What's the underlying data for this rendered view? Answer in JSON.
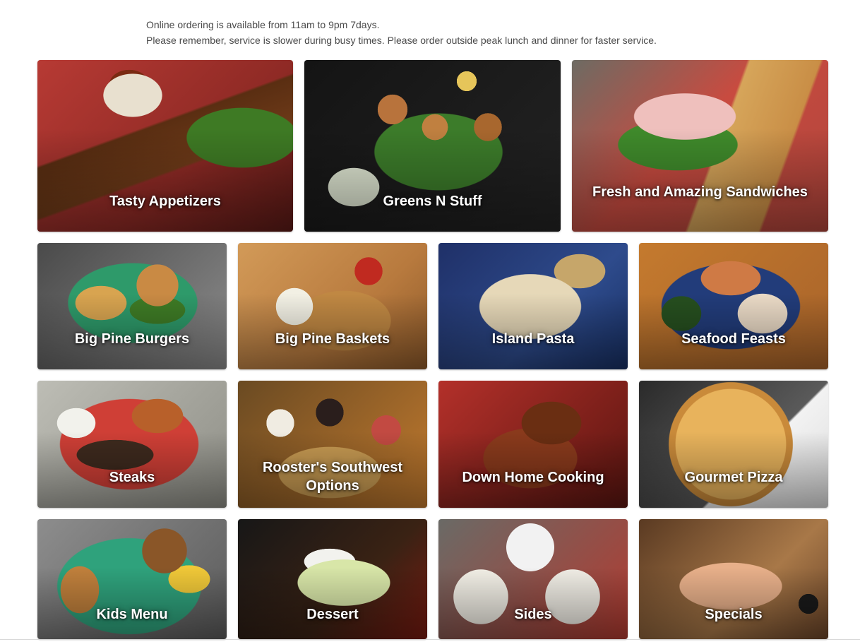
{
  "notice": {
    "line1": "Online ordering is available from 11am to 9pm 7days.",
    "line2": "Please remember, service is slower during busy times. Please order outside peak lunch and dinner for faster service."
  },
  "categories": [
    {
      "label": "Tasty Appetizers"
    },
    {
      "label": "Greens N Stuff"
    },
    {
      "label": "Fresh and Amazing Sandwiches"
    },
    {
      "label": "Big Pine Burgers"
    },
    {
      "label": "Big Pine Baskets"
    },
    {
      "label": "Island Pasta"
    },
    {
      "label": "Seafood Feasts"
    },
    {
      "label": "Steaks"
    },
    {
      "label": "Rooster's Southwest Options"
    },
    {
      "label": "Down Home Cooking"
    },
    {
      "label": "Gourmet Pizza"
    },
    {
      "label": "Kids Menu"
    },
    {
      "label": "Dessert"
    },
    {
      "label": "Sides"
    },
    {
      "label": "Specials"
    }
  ]
}
